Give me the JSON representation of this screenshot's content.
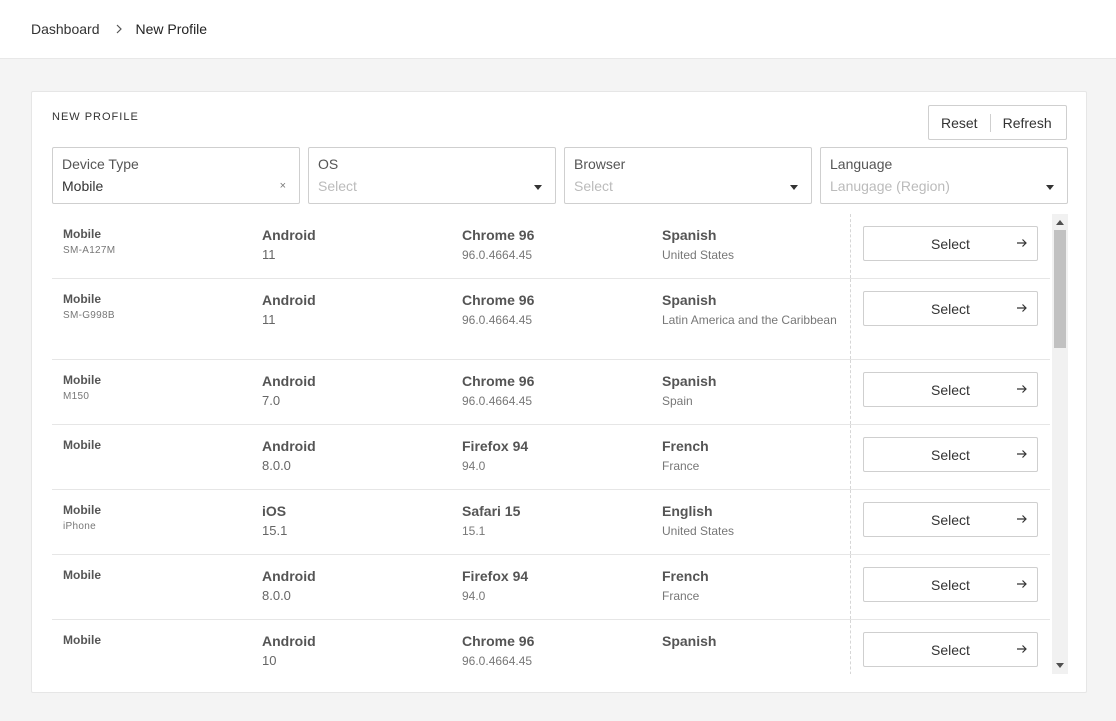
{
  "breadcrumb": {
    "root": "Dashboard",
    "separator_icon": "chevron-right-icon",
    "current": "New Profile"
  },
  "card": {
    "title": "NEW PROFILE",
    "reset_label": "Reset",
    "refresh_label": "Refresh"
  },
  "filters": {
    "device_type": {
      "label": "Device Type",
      "value": "Mobile",
      "clear_icon": "×"
    },
    "os": {
      "label": "OS",
      "placeholder": "Select"
    },
    "browser": {
      "label": "Browser",
      "placeholder": "Select"
    },
    "language": {
      "label": "Language",
      "placeholder": "Lanugage (Region)"
    }
  },
  "rows": [
    {
      "device": "Mobile",
      "model": "SM-A127M",
      "os": "Android",
      "os_version": "11",
      "browser": "Chrome 96",
      "browser_version": "96.0.4664.45",
      "language": "Spanish",
      "region": "United States",
      "action": "Select"
    },
    {
      "device": "Mobile",
      "model": "SM-G998B",
      "os": "Android",
      "os_version": "11",
      "browser": "Chrome 96",
      "browser_version": "96.0.4664.45",
      "language": "Spanish",
      "region": "Latin America and the Caribbean",
      "action": "Select"
    },
    {
      "device": "Mobile",
      "model": "M150",
      "os": "Android",
      "os_version": "7.0",
      "browser": "Chrome 96",
      "browser_version": "96.0.4664.45",
      "language": "Spanish",
      "region": "Spain",
      "action": "Select"
    },
    {
      "device": "Mobile",
      "model": "",
      "os": "Android",
      "os_version": "8.0.0",
      "browser": "Firefox 94",
      "browser_version": "94.0",
      "language": "French",
      "region": "France",
      "action": "Select"
    },
    {
      "device": "Mobile",
      "model": "iPhone",
      "os": "iOS",
      "os_version": "15.1",
      "browser": "Safari 15",
      "browser_version": "15.1",
      "language": "English",
      "region": "United States",
      "action": "Select"
    },
    {
      "device": "Mobile",
      "model": "",
      "os": "Android",
      "os_version": "8.0.0",
      "browser": "Firefox 94",
      "browser_version": "94.0",
      "language": "French",
      "region": "France",
      "action": "Select"
    },
    {
      "device": "Mobile",
      "model": "",
      "os": "Android",
      "os_version": "10",
      "browser": "Chrome 96",
      "browser_version": "96.0.4664.45",
      "language": "Spanish",
      "region": "",
      "action": "Select"
    }
  ],
  "colors": {
    "page_bg": "#f4f4f4",
    "card_bg": "#ffffff",
    "border": "#cfcfcf",
    "text": "#333333"
  }
}
